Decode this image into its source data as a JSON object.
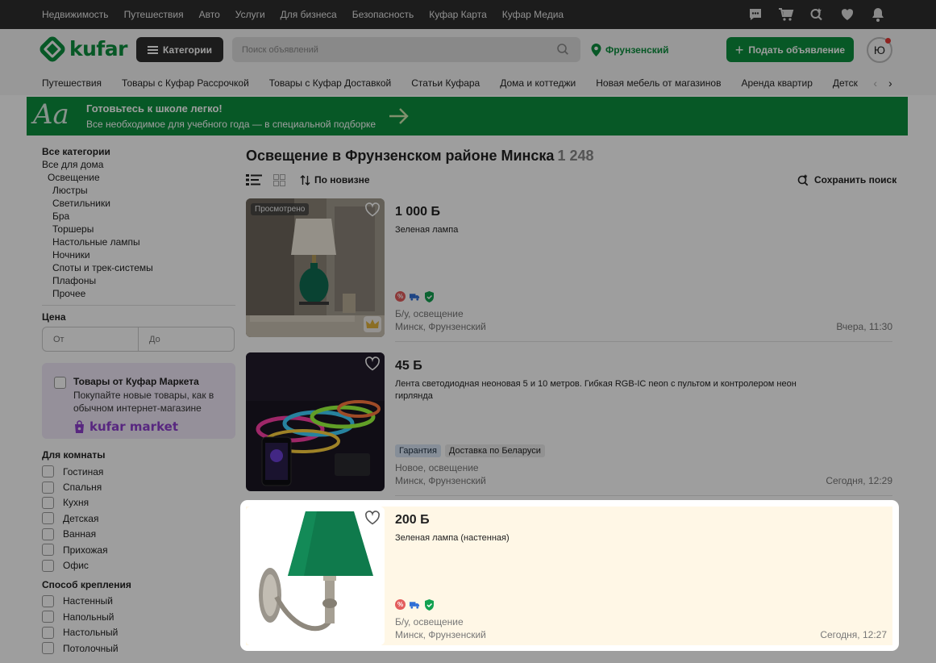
{
  "topbar": {
    "links": [
      "Недвижимость",
      "Путешествия",
      "Авто",
      "Услуги",
      "Для бизнеса",
      "Безопасность",
      "Куфар Карта",
      "Куфар Медиа"
    ]
  },
  "header": {
    "logo": "kufar",
    "categories_label": "Категории",
    "search_placeholder": "Поиск объявлений",
    "location": "Фрунзенский",
    "post_label": "Подать объявление",
    "avatar_letter": "Ю"
  },
  "category_strip": [
    "Путешествия",
    "Товары с Куфар Рассрочкой",
    "Товары с Куфар Доставкой",
    "Статьи Куфара",
    "Дома и коттеджи",
    "Новая мебель от магазинов",
    "Аренда квартир",
    "Детск"
  ],
  "banner": {
    "glyph": "Aa",
    "title": "Готовьтесь к школе легко!",
    "subtitle": "Все необходимое для учебного года — в специальной подборке"
  },
  "sidebar": {
    "all_categories": "Все категории",
    "parent": "Все для дома",
    "current": "Освещение",
    "subcategories": [
      "Люстры",
      "Светильники",
      "Бра",
      "Торшеры",
      "Настольные лампы",
      "Ночники",
      "Споты и трек-системы",
      "Плафоны",
      "Прочее"
    ],
    "price_heading": "Цена",
    "price_from_placeholder": "От",
    "price_to_placeholder": "До",
    "market": {
      "title": "Товары от Куфар Маркета",
      "description": "Покупайте новые товары, как в обычном интернет-магазине",
      "logo": "kufar market"
    },
    "rooms_heading": "Для комнаты",
    "rooms": [
      "Гостиная",
      "Спальня",
      "Кухня",
      "Детская",
      "Ванная",
      "Прихожая",
      "Офис"
    ],
    "mount_heading": "Способ крепления",
    "mounts": [
      "Настенный",
      "Напольный",
      "Настольный",
      "Потолочный"
    ]
  },
  "main": {
    "title": "Освещение в Фрунзенском районе Минска",
    "count": "1 248",
    "sort_label": "По новизне",
    "save_search_label": "Сохранить поиск"
  },
  "listings": [
    {
      "viewed_label": "Просмотрено",
      "price": "1 000 Б",
      "title": "Зеленая лампа",
      "condition": "Б/у, освещение",
      "location": "Минск, Фрунзенский",
      "date": "Вчера, 11:30"
    },
    {
      "price": "45 Б",
      "title": "Лента светодиодная неоновая 5 и 10 метров. Гибкая RGB-IC neon с пультом и контролером неон гирлянда",
      "tags": [
        "Гарантия",
        "Доставка по Беларуси"
      ],
      "condition": "Новое, освещение",
      "location": "Минск, Фрунзенский",
      "date": "Сегодня, 12:29"
    },
    {
      "price": "200 Б",
      "title": "Зеленая лампа (настенная)",
      "condition": "Б/у, освещение",
      "location": "Минск, Фрунзенский",
      "date": "Сегодня, 12:27"
    }
  ],
  "colors": {
    "brand": "#0c8f3e",
    "dark": "#2e2e2e",
    "highlight_bg": "#fff7e6",
    "market": "#8e3fcf"
  }
}
